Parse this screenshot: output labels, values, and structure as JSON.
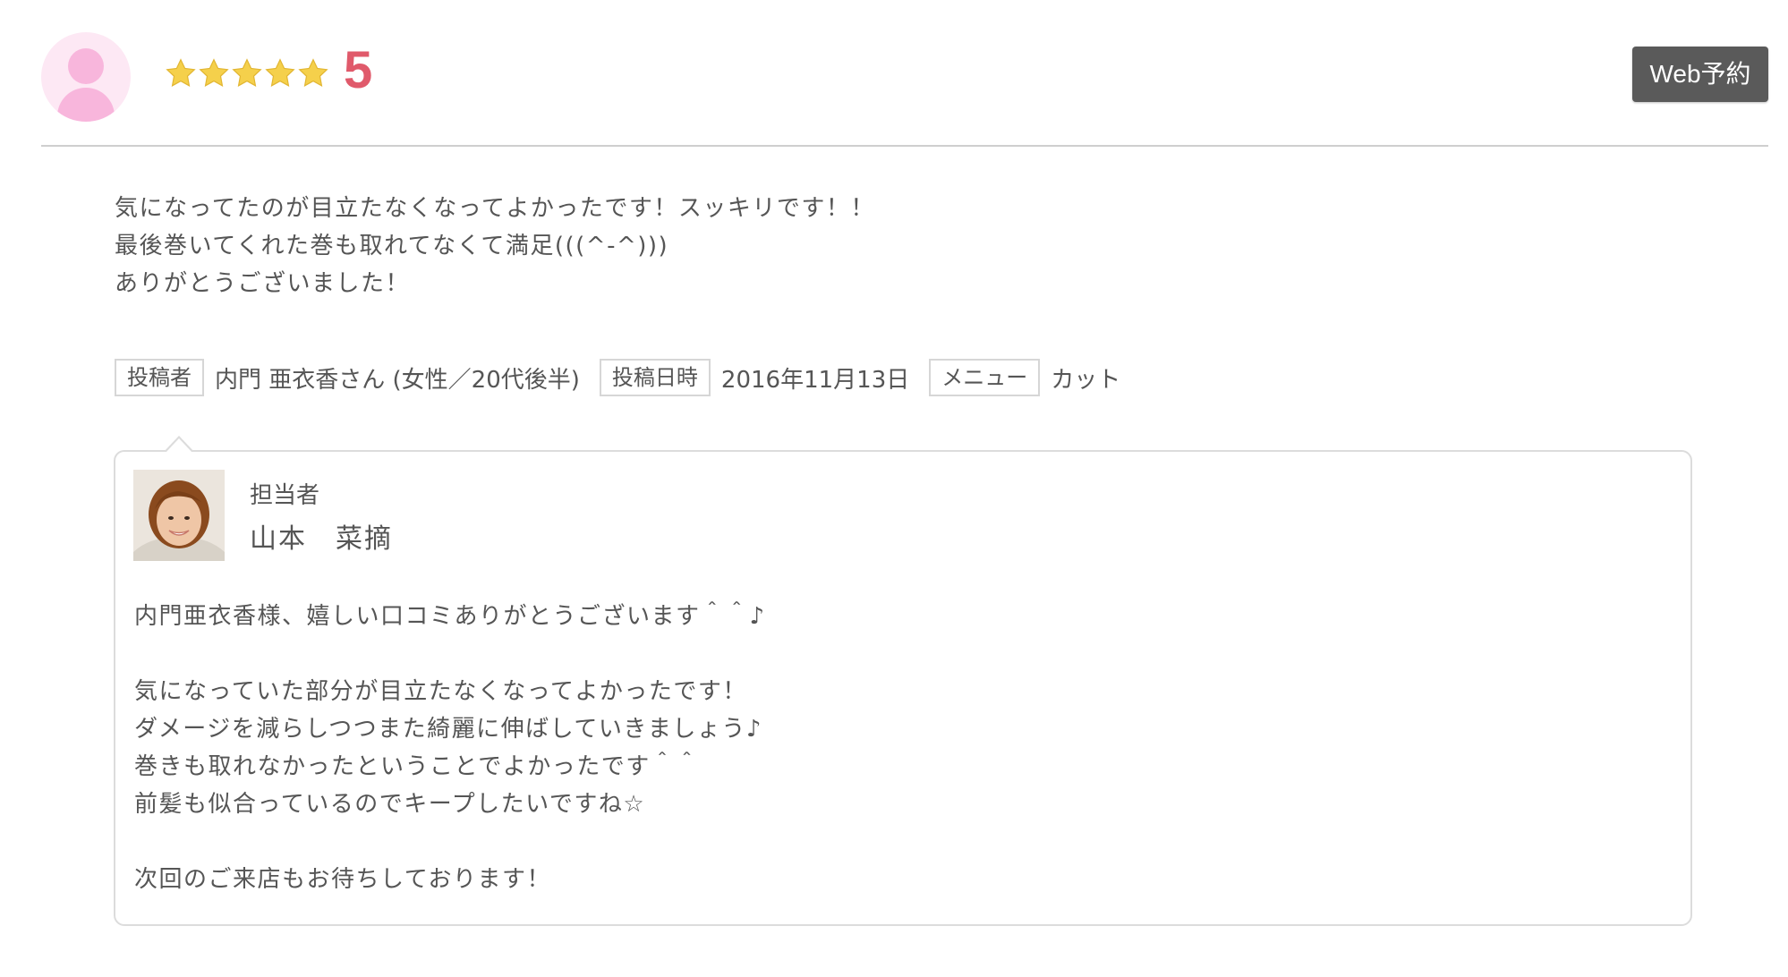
{
  "header": {
    "rating_value": "5",
    "star_count": 5,
    "star_color": "#f5d04b",
    "rating_color": "#e05a6b",
    "web_reserve_label": "Web予約"
  },
  "review": {
    "lines": [
      "気になってたのが目立たなくなってよかったです！スッキリです！！",
      "最後巻いてくれた巻も取れてなくて満足(((^-^)))",
      "ありがとうございました！"
    ]
  },
  "meta": {
    "poster_label": "投稿者",
    "poster_value": "内門 亜衣香さん (女性／20代後半)",
    "date_label": "投稿日時",
    "date_value": "2016年11月13日",
    "menu_label": "メニュー",
    "menu_value": "カット"
  },
  "reply": {
    "staff_label": "担当者",
    "staff_name": "山本　菜摘",
    "lines": [
      "内門亜衣香様、嬉しい口コミありがとうございます＾＾♪",
      "",
      "気になっていた部分が目立たなくなってよかったです！",
      "ダメージを減らしつつまた綺麗に伸ばしていきましょう♪",
      "巻きも取れなかったということでよかったです＾＾",
      "前髪も似合っているのでキープしたいですね☆",
      "",
      "次回のご来店もお待ちしております！"
    ]
  }
}
